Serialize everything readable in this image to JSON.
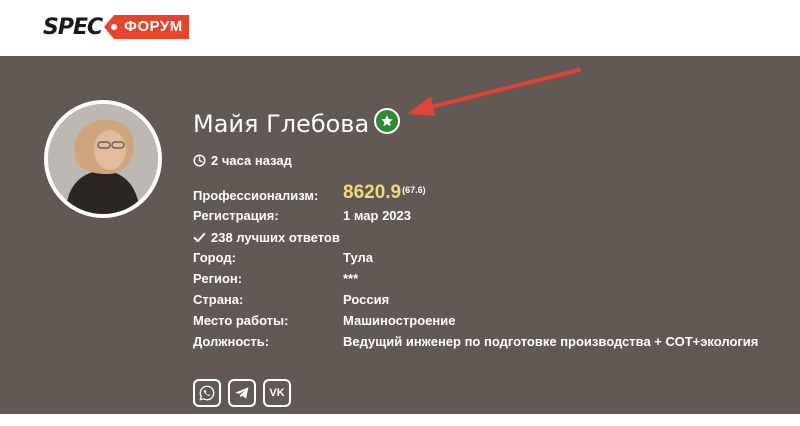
{
  "header": {
    "logo_spec": "SPEC",
    "logo_forum": "ФОРУМ",
    "colors": {
      "brand_red": "#e8432b",
      "panel": "#625954"
    }
  },
  "profile": {
    "name": "Майя Глебова",
    "badge_icon": "star-icon",
    "last_seen": "2 часа назад",
    "professionalism_label": "Профессионализм:",
    "professionalism_value": "8620.9",
    "professionalism_sub": "(67.6)",
    "registration_label": "Регистрация:",
    "registration_value": "1 мар 2023",
    "best_answers": "238 лучших ответов",
    "city_label": "Город:",
    "city_value": "Тула",
    "region_label": "Регион:",
    "region_value": "***",
    "country_label": "Страна:",
    "country_value": "Россия",
    "workplace_label": "Место работы:",
    "workplace_value": "Машиностроение",
    "position_label": "Должность:",
    "position_value": "Ведущий инженер по подготовке производства + СОТ+экология"
  },
  "socials": [
    {
      "icon": "whatsapp-icon"
    },
    {
      "icon": "telegram-icon"
    },
    {
      "icon": "vk-icon",
      "label": "VK"
    }
  ]
}
